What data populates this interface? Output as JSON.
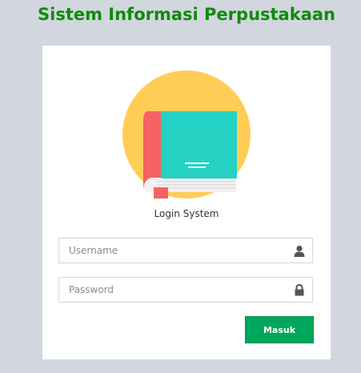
{
  "app": {
    "title": "Sistem Informasi Perpustakaan"
  },
  "login": {
    "message": "Login System",
    "username_placeholder": "Username",
    "username_value": "",
    "password_placeholder": "Password",
    "password_value": "",
    "submit_label": "Masuk"
  },
  "icons": {
    "logo": "book-logo-icon",
    "username": "user-icon",
    "password": "lock-icon"
  },
  "colors": {
    "title": "#118a0d",
    "page_background": "#d2d6de",
    "submit_button": "#00a65a",
    "logo_circle": "#ffcd56",
    "book_cover": "#25d2c4",
    "book_spine": "#f46263"
  }
}
